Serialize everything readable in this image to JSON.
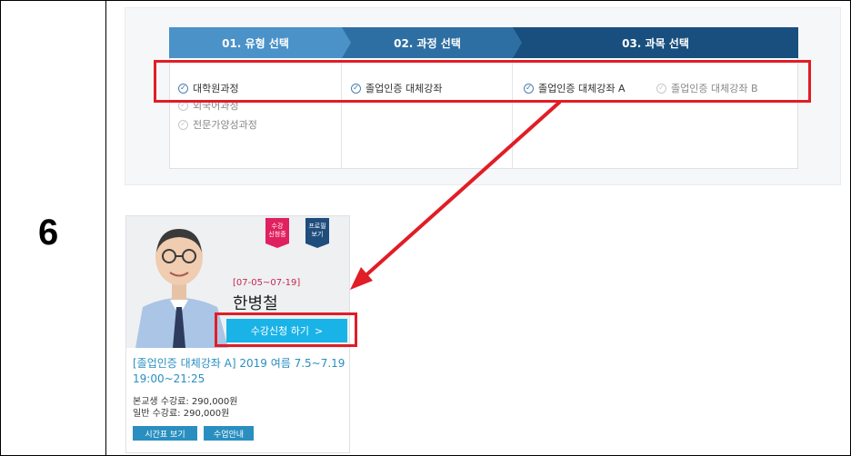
{
  "step_number": "6",
  "tabs": [
    {
      "label": "01. 유형 선택"
    },
    {
      "label": "02. 과정 선택"
    },
    {
      "label": "03. 과목 선택"
    }
  ],
  "type_options": [
    {
      "label": "대학원과정",
      "checked": true
    },
    {
      "label": "외국어과정",
      "checked": false
    },
    {
      "label": "전문가양성과정",
      "checked": false
    }
  ],
  "course_options": [
    {
      "label": "졸업인증 대체강좌",
      "checked": true
    }
  ],
  "subject_options": [
    {
      "label": "졸업인증 대체강좌 A",
      "checked": true
    },
    {
      "label": "졸업인증 대체강좌 B",
      "checked": false
    }
  ],
  "card": {
    "badge_status": [
      "수강",
      "신청중"
    ],
    "badge_profile": [
      "프로필",
      "보기"
    ],
    "date_range": "[07-05~07-19]",
    "instructor": "한병철",
    "apply_label": "수강신청 하기",
    "apply_arrow": ">",
    "title": "[졸업인증 대체강좌 A] 2019 여름 7.5~7.19 19:00~21:25",
    "fee_student": "본교생 수강료: 290,000원",
    "fee_general": "일반 수강료: 290,000원",
    "btn_timetable": "시간표 보기",
    "btn_info": "수업안내"
  },
  "colors": {
    "highlight": "#e11d26",
    "tab1": "#4b92c8",
    "tab2": "#2e6fa3",
    "tab3": "#184f7e",
    "apply": "#1ab3e7",
    "badge_status": "#e0215f",
    "badge_profile": "#1f4d7c"
  }
}
